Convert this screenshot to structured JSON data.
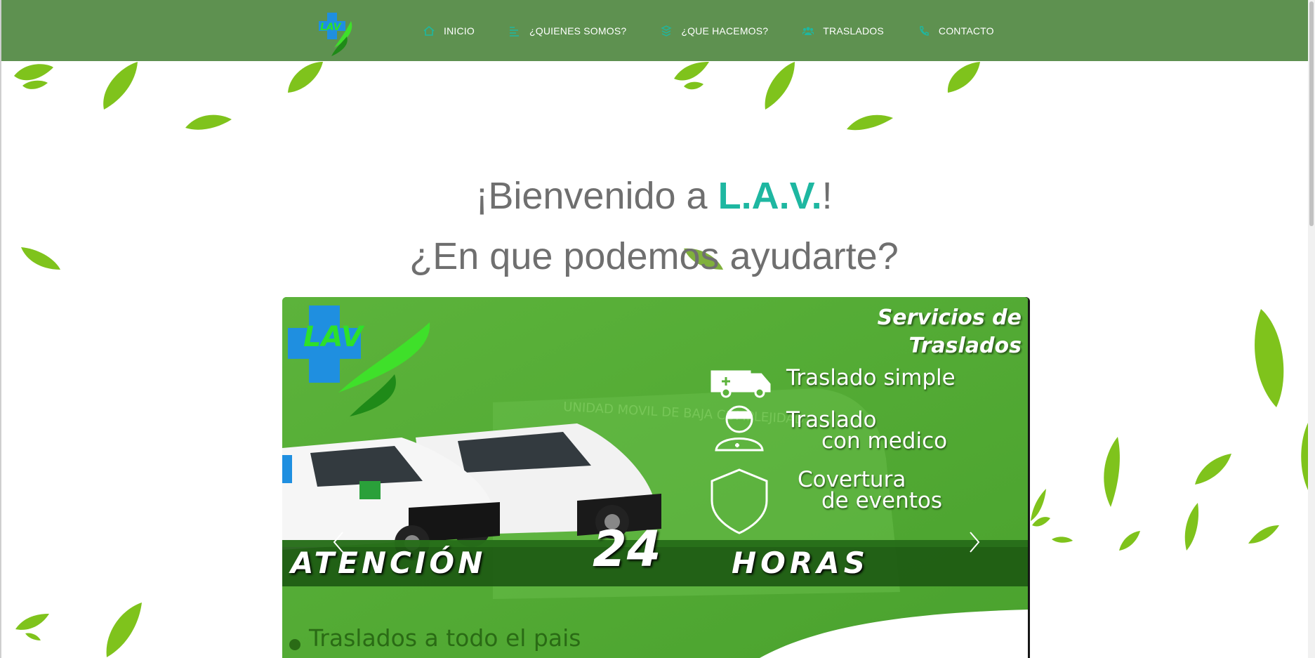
{
  "navbar": {
    "logo_text": "LAV",
    "items": [
      {
        "label": "INICIO",
        "icon": "home-icon"
      },
      {
        "label": "¿QUIENES SOMOS?",
        "icon": "list-icon"
      },
      {
        "label": "¿QUE HACEMOS?",
        "icon": "layers-icon"
      },
      {
        "label": "TRASLADOS",
        "icon": "users-icon"
      },
      {
        "label": "CONTACTO",
        "icon": "phone-icon"
      }
    ]
  },
  "hero": {
    "welcome_prefix": "¡Bienvenido a ",
    "welcome_brand": "L.A.V.",
    "welcome_suffix": "!",
    "question": "¿En que podemos ayudarte?"
  },
  "carousel": {
    "logo_text": "LAV",
    "services_title_line1": "Servicios de",
    "services_title_line2": "Traslados",
    "services": [
      {
        "line1": "Traslado simple",
        "line2": "",
        "icon": "ambulance-icon"
      },
      {
        "line1": "Traslado",
        "line2": "con medico",
        "icon": "doctor-icon"
      },
      {
        "line1": "Covertura",
        "line2": "de eventos",
        "icon": "shield-icon"
      }
    ],
    "banner_left": "ATENCIÓN",
    "banner_number": "24",
    "banner_right": "HORAS",
    "bottom_text": "Traslados a todo el pais",
    "vehicle_text": "UNIDAD MOVIL DE BAJA COMPLEJIDAD"
  },
  "colors": {
    "navbar_bg": "#5e9150",
    "brand_teal": "#1eb7a1",
    "heading_gray": "#6f6f6f",
    "slide_green": "#5cb33b",
    "leaf_green": "#7fc31c"
  }
}
